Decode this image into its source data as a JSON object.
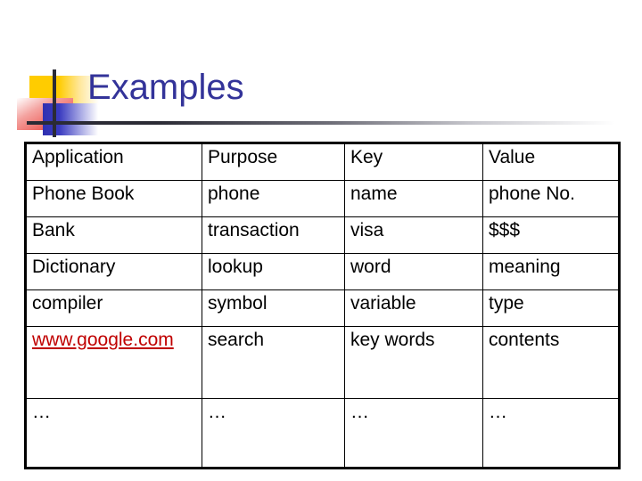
{
  "slide": {
    "title": "Examples",
    "title_color": "#333399",
    "decor": {
      "yellow_color": "#FFCC00",
      "red_color": "#E8302A",
      "blue_color": "#2F30B0",
      "rule_color": "#2B2B35"
    }
  },
  "table": {
    "columns": [
      "Application",
      "Purpose",
      "Key",
      "Value"
    ],
    "link_color": "#C00000",
    "rows": [
      {
        "application": "Phone Book",
        "purpose": "phone",
        "key": "name",
        "value": "phone No.",
        "is_link": false
      },
      {
        "application": "Bank",
        "purpose": "transaction",
        "key": "visa",
        "value": "$$$",
        "is_link": false
      },
      {
        "application": "Dictionary",
        "purpose": "lookup",
        "key": "word",
        "value": "meaning",
        "is_link": false
      },
      {
        "application": "compiler",
        "purpose": "symbol",
        "key": "variable",
        "value": "type",
        "is_link": false
      },
      {
        "application": "www.google.com",
        "purpose": "search",
        "key": "key words",
        "value": "contents",
        "is_link": true
      },
      {
        "application": "…",
        "purpose": "…",
        "key": "…",
        "value": "…",
        "is_link": false
      }
    ]
  }
}
